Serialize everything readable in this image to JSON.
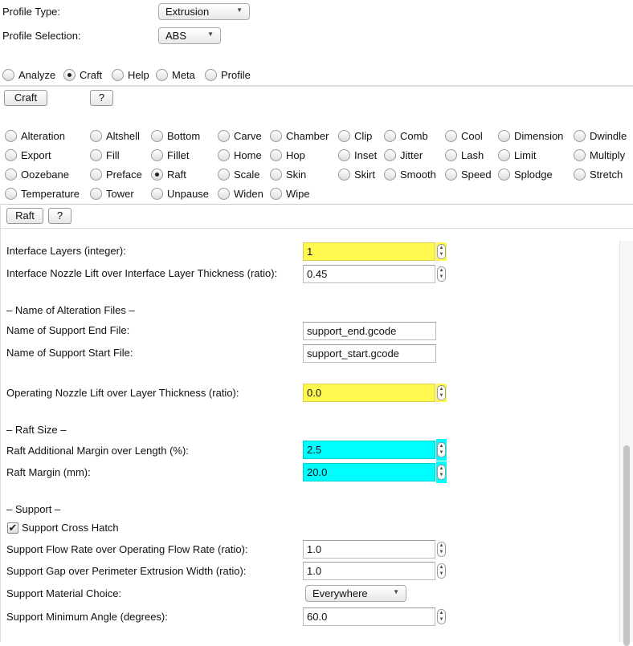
{
  "profile": {
    "type_label": "Profile Type:",
    "type_value": "Extrusion",
    "selection_label": "Profile Selection:",
    "selection_value": "ABS"
  },
  "modes": [
    {
      "label": "Analyze",
      "checked": false
    },
    {
      "label": "Craft",
      "checked": true
    },
    {
      "label": "Help",
      "checked": false
    },
    {
      "label": "Meta",
      "checked": false
    },
    {
      "label": "Profile",
      "checked": false
    }
  ],
  "craft_button": "Craft",
  "help_button": "?",
  "plugins": [
    [
      "Alteration",
      "Altshell",
      "Bottom",
      "Carve",
      "Chamber",
      "Clip",
      "Comb",
      "Cool",
      "Dimension",
      "Dwindle"
    ],
    [
      "Export",
      "Fill",
      "Fillet",
      "Home",
      "Hop",
      "Inset",
      "Jitter",
      "Lash",
      "Limit",
      "Multiply"
    ],
    [
      "Oozebane",
      "Preface",
      "Raft",
      "Scale",
      "Skin",
      "Skirt",
      "Smooth",
      "Speed",
      "Splodge",
      "Stretch"
    ],
    [
      "Temperature",
      "Tower",
      "Unpause",
      "Widen",
      "Wipe"
    ]
  ],
  "selected_plugin": "Raft",
  "raft_button": "Raft",
  "raft_help_button": "?",
  "settings": {
    "interface_layers": {
      "label": "Interface Layers (integer):",
      "value": "1"
    },
    "interface_nozzle_lift": {
      "label": "Interface Nozzle Lift over Interface Layer Thickness (ratio):",
      "value": "0.45"
    },
    "alteration_header": "– Name of Alteration Files –",
    "support_end_file": {
      "label": "Name of Support End File:",
      "value": "support_end.gcode"
    },
    "support_start_file": {
      "label": "Name of Support Start File:",
      "value": "support_start.gcode"
    },
    "operating_nozzle_lift": {
      "label": "Operating Nozzle Lift over Layer Thickness (ratio):",
      "value": "0.0"
    },
    "raft_size_header": "– Raft Size –",
    "raft_additional_margin": {
      "label": "Raft Additional Margin over Length (%):",
      "value": "2.5"
    },
    "raft_margin": {
      "label": "Raft Margin (mm):",
      "value": "20.0"
    },
    "support_header": "– Support –",
    "support_cross_hatch": {
      "label": "Support Cross Hatch",
      "checked": true
    },
    "support_flow_rate": {
      "label": "Support Flow Rate over Operating Flow Rate (ratio):",
      "value": "1.0"
    },
    "support_gap": {
      "label": "Support Gap over Perimeter Extrusion Width (ratio):",
      "value": "1.0"
    },
    "support_material_choice": {
      "label": "Support Material Choice:",
      "value": "Everywhere"
    },
    "support_minimum_angle": {
      "label": "Support Minimum Angle (degrees):",
      "value": "60.0"
    }
  },
  "colors": {
    "highlight_yellow": "#fff84f",
    "highlight_cyan": "#00fdfe"
  }
}
